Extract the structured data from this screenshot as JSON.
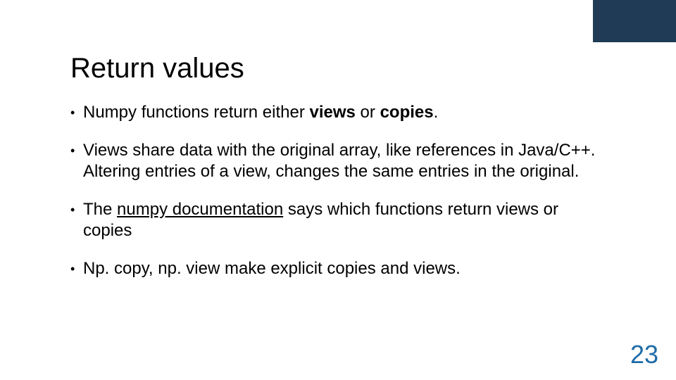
{
  "accent_color": "#1f3b55",
  "title": "Return values",
  "bullets": {
    "b1_pre": "Numpy functions return either ",
    "b1_bold1": "views",
    "b1_mid": " or ",
    "b1_bold2": "copies",
    "b1_post": ".",
    "b2": "Views share data with the original array, like references in Java/C++. Altering entries of a view, changes the same entries in the original.",
    "b3_pre": "The ",
    "b3_link": "numpy documentation",
    "b3_post": " says which functions return views or copies",
    "b4": "Np. copy, np. view make explicit copies and views."
  },
  "page_number": "23"
}
